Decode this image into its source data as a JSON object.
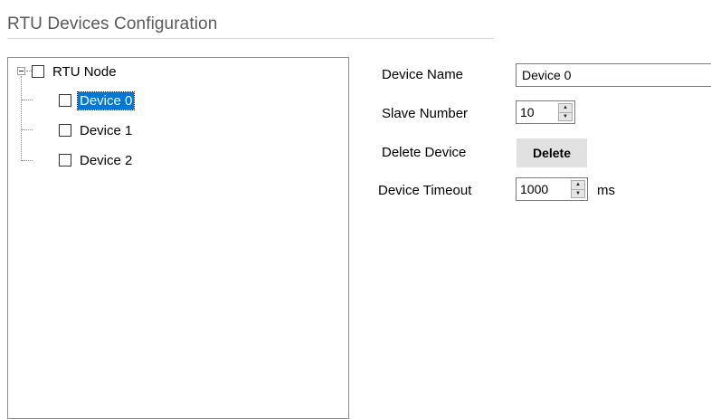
{
  "section_title": "RTU Devices Configuration",
  "tree": {
    "root_label": "RTU Node",
    "devices": [
      {
        "label": "Device 0",
        "selected": true
      },
      {
        "label": "Device 1",
        "selected": false
      },
      {
        "label": "Device 2",
        "selected": false
      }
    ]
  },
  "form": {
    "device_name_label": "Device Name",
    "device_name_value": "Device 0",
    "slave_number_label": "Slave Number",
    "slave_number_value": "10",
    "delete_device_label": "Delete Device",
    "delete_button_label": "Delete",
    "device_timeout_label": "Device Timeout",
    "device_timeout_value": "1000",
    "timeout_unit": "ms"
  },
  "colors": {
    "selection": "#0078d7",
    "button_bg": "#e1e1e1",
    "title_text": "#5a5a5a"
  }
}
